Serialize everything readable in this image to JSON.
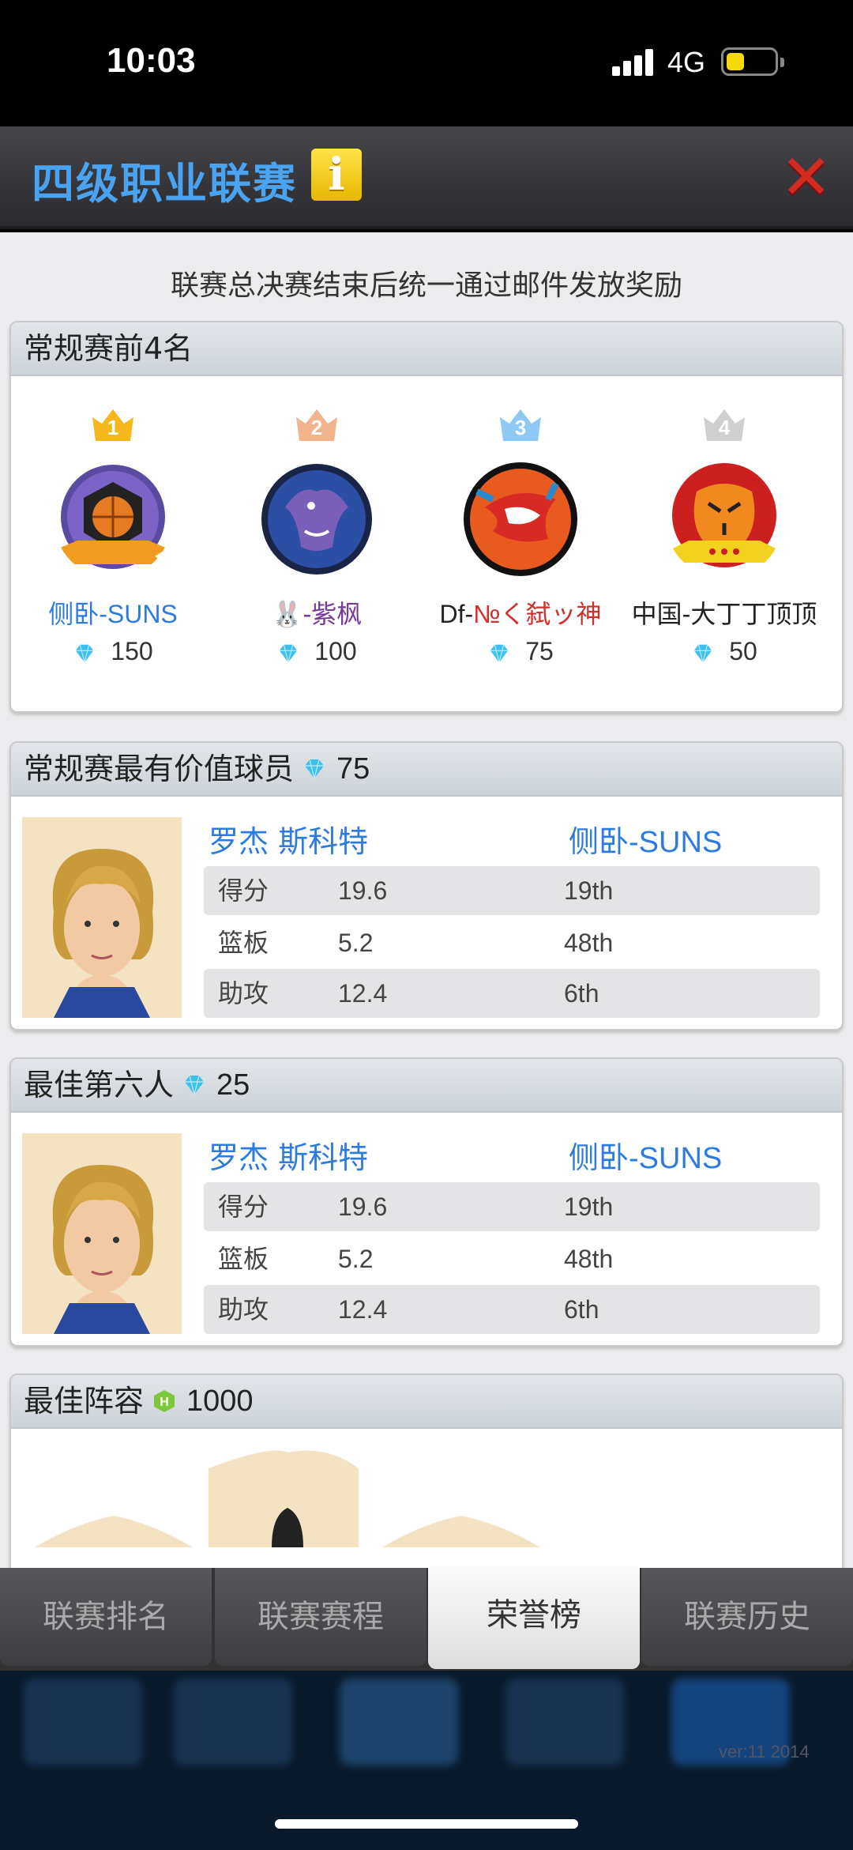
{
  "status_bar": {
    "time": "10:03",
    "network": "4G"
  },
  "header": {
    "title": "四级职业联赛",
    "info_label": "i",
    "close_label": "✕"
  },
  "notice": "联赛总决赛结束后统一通过邮件发放奖励",
  "top4": {
    "title": "常规赛前4名",
    "teams": [
      {
        "rank": "1",
        "name": "侧卧-SUNS",
        "gems": "150",
        "name_color": "#2d7be0",
        "crown_color": "#f5b81c"
      },
      {
        "rank": "2",
        "name": "🐰-紫枫",
        "gems": "100",
        "name_color": "#7a3a9a",
        "crown_color": "#f1b48c"
      },
      {
        "rank": "3",
        "name_prefix": "Df-",
        "name_suffix": "№く弑ッ神",
        "gems": "75",
        "name_color": "#d0302a",
        "crown_color": "#8ec8f5"
      },
      {
        "rank": "4",
        "name": "中国-大丁丁顶顶",
        "gems": "50",
        "name_color": "#222222",
        "crown_color": "#cfcfcf"
      }
    ]
  },
  "mvp": {
    "title": "常规赛最有价值球员",
    "gems": "75",
    "player": "罗杰 斯科特",
    "team": "侧卧-SUNS",
    "stats": [
      {
        "label": "得分",
        "value": "19.6",
        "rank": "19th"
      },
      {
        "label": "篮板",
        "value": "5.2",
        "rank": "48th"
      },
      {
        "label": "助攻",
        "value": "12.4",
        "rank": "6th"
      }
    ]
  },
  "sixth": {
    "title": "最佳第六人",
    "gems": "25",
    "player": "罗杰 斯科特",
    "team": "侧卧-SUNS",
    "stats": [
      {
        "label": "得分",
        "value": "19.6",
        "rank": "19th"
      },
      {
        "label": "篮板",
        "value": "5.2",
        "rank": "48th"
      },
      {
        "label": "助攻",
        "value": "12.4",
        "rank": "6th"
      }
    ]
  },
  "lineup": {
    "title": "最佳阵容",
    "reward_icon": "h-coin-icon",
    "reward": "1000"
  },
  "tabs": [
    "联赛排名",
    "联赛赛程",
    "荣誉榜",
    "联赛历史"
  ],
  "version": "ver:11  2014",
  "colors": {
    "accent": "#2d7be0",
    "title_blue": "#4aa3f0",
    "close_red": "#d12b22"
  }
}
